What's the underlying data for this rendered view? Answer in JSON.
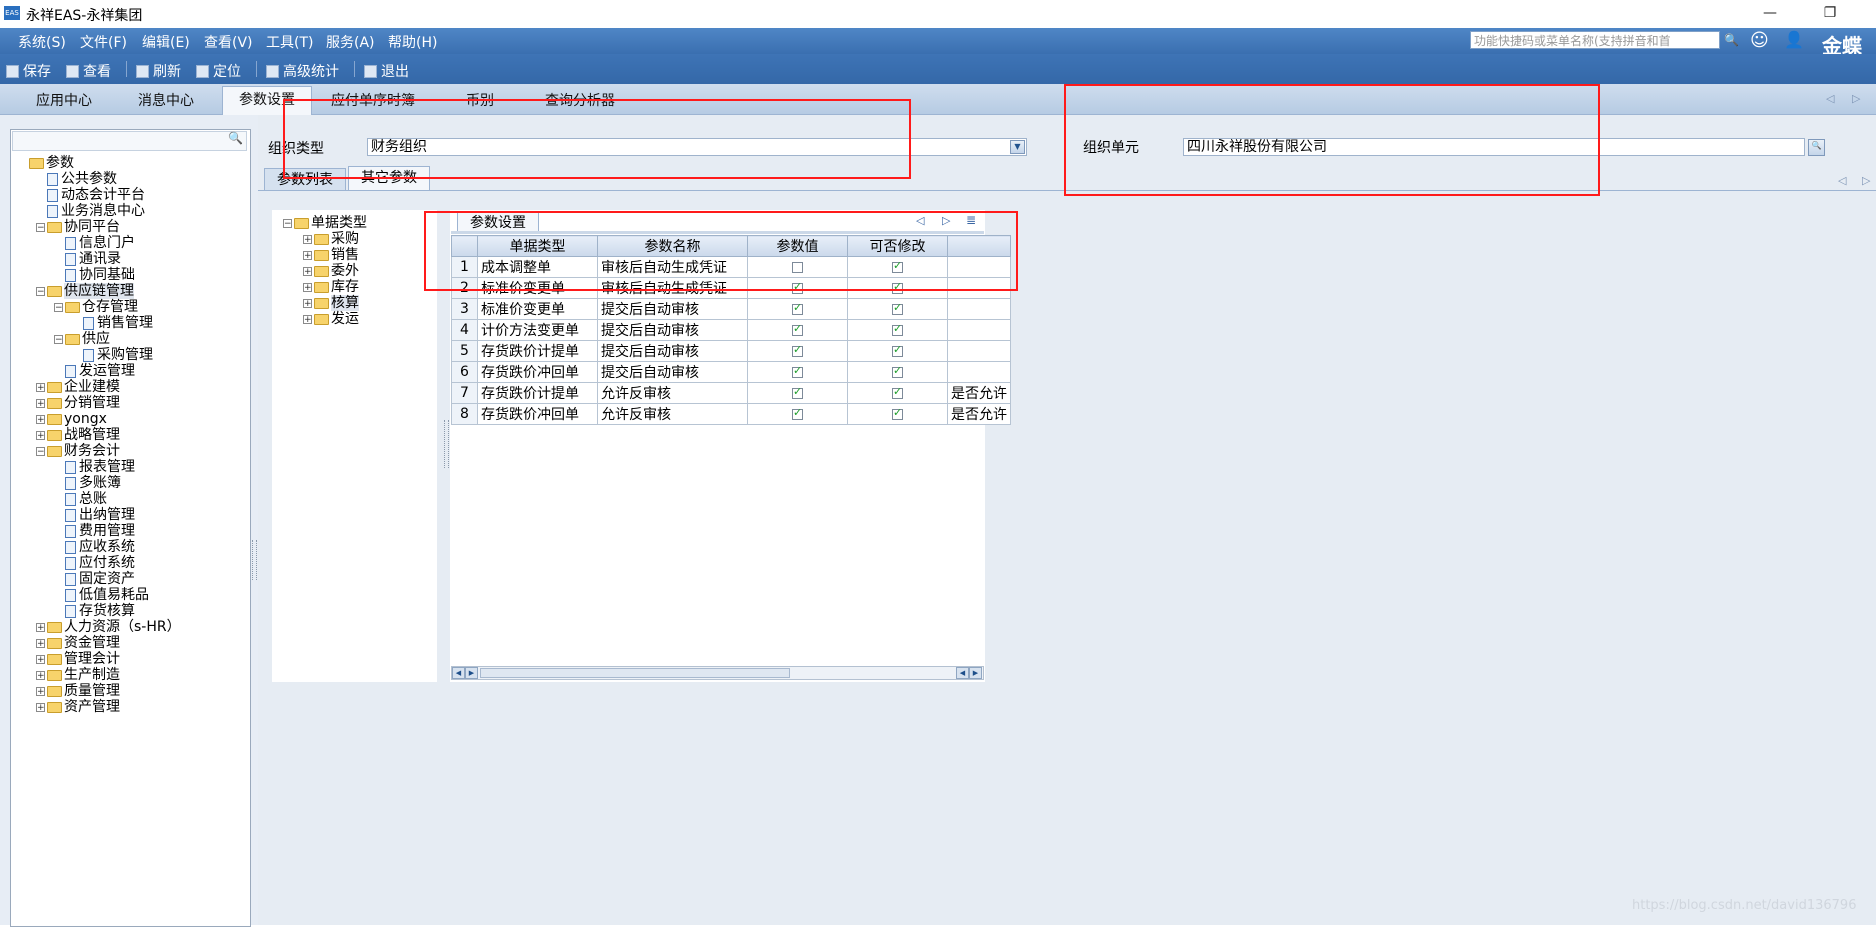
{
  "window": {
    "title": "永祥EAS-永祥集团",
    "app_icon_text": "EAS",
    "minimize_glyph": "—",
    "restore_glyph": "❐"
  },
  "menubar": {
    "items": [
      "系统(S)",
      "文件(F)",
      "编辑(E)",
      "查看(V)",
      "工具(T)",
      "服务(A)",
      "帮助(H)"
    ],
    "quick_search_placeholder": "功能快捷码或菜单名称(支持拼音和首",
    "brand": "金蝶"
  },
  "toolbar": {
    "save": "保存",
    "view": "查看",
    "refresh": "刷新",
    "locate": "定位",
    "advanced_stats": "高级统计",
    "exit": "退出"
  },
  "tabs": [
    {
      "label": "应用中心"
    },
    {
      "label": "消息中心"
    },
    {
      "label": "参数设置"
    },
    {
      "label": "应付单序时簿"
    },
    {
      "label": "币别"
    },
    {
      "label": "查询分析器"
    }
  ],
  "nav_tree": [
    {
      "label": "参数",
      "type": "folder",
      "exp": "",
      "level": 0
    },
    {
      "label": "公共参数",
      "type": "doc",
      "exp": "",
      "level": 1
    },
    {
      "label": "动态会计平台",
      "type": "doc",
      "exp": "",
      "level": 1
    },
    {
      "label": "业务消息中心",
      "type": "doc",
      "exp": "",
      "level": 1
    },
    {
      "label": "协同平台",
      "type": "folder",
      "exp": "-",
      "level": 1
    },
    {
      "label": "信息门户",
      "type": "doc",
      "exp": "",
      "level": 2
    },
    {
      "label": "通讯录",
      "type": "doc",
      "exp": "",
      "level": 2
    },
    {
      "label": "协同基础",
      "type": "doc",
      "exp": "",
      "level": 2
    },
    {
      "label": "供应链管理",
      "type": "folder",
      "exp": "-",
      "level": 1,
      "selected": true
    },
    {
      "label": "仓存管理",
      "type": "folder",
      "exp": "-",
      "level": 2
    },
    {
      "label": "销售管理",
      "type": "doc",
      "exp": "",
      "level": 3
    },
    {
      "label": "供应",
      "type": "folder",
      "exp": "-",
      "level": 2
    },
    {
      "label": "采购管理",
      "type": "doc",
      "exp": "",
      "level": 3
    },
    {
      "label": "发运管理",
      "type": "doc",
      "exp": "",
      "level": 2
    },
    {
      "label": "企业建模",
      "type": "folder",
      "exp": "+",
      "level": 1
    },
    {
      "label": "分销管理",
      "type": "folder",
      "exp": "+",
      "level": 1
    },
    {
      "label": "yongx",
      "type": "folder",
      "exp": "+",
      "level": 1
    },
    {
      "label": "战略管理",
      "type": "folder",
      "exp": "+",
      "level": 1
    },
    {
      "label": "财务会计",
      "type": "folder",
      "exp": "-",
      "level": 1
    },
    {
      "label": "报表管理",
      "type": "doc",
      "exp": "",
      "level": 2
    },
    {
      "label": "多账簿",
      "type": "doc",
      "exp": "",
      "level": 2
    },
    {
      "label": "总账",
      "type": "doc",
      "exp": "",
      "level": 2
    },
    {
      "label": "出纳管理",
      "type": "doc",
      "exp": "",
      "level": 2
    },
    {
      "label": "费用管理",
      "type": "doc",
      "exp": "",
      "level": 2
    },
    {
      "label": "应收系统",
      "type": "doc",
      "exp": "",
      "level": 2
    },
    {
      "label": "应付系统",
      "type": "doc",
      "exp": "",
      "level": 2
    },
    {
      "label": "固定资产",
      "type": "doc",
      "exp": "",
      "level": 2
    },
    {
      "label": "低值易耗品",
      "type": "doc",
      "exp": "",
      "level": 2
    },
    {
      "label": "存货核算",
      "type": "doc",
      "exp": "",
      "level": 2
    },
    {
      "label": "人力资源（s-HR）",
      "type": "folder",
      "exp": "+",
      "level": 1
    },
    {
      "label": "资金管理",
      "type": "folder",
      "exp": "+",
      "level": 1
    },
    {
      "label": "管理会计",
      "type": "folder",
      "exp": "+",
      "level": 1
    },
    {
      "label": "生产制造",
      "type": "folder",
      "exp": "+",
      "level": 1
    },
    {
      "label": "质量管理",
      "type": "folder",
      "exp": "+",
      "level": 1
    },
    {
      "label": "资产管理",
      "type": "folder",
      "exp": "+",
      "level": 1
    }
  ],
  "form": {
    "org_type_label": "组织类型",
    "org_type_value": "财务组织",
    "org_unit_label": "组织单元",
    "org_unit_value": "四川永祥股份有限公司"
  },
  "sub_tabs": [
    "参数列表",
    "其它参数"
  ],
  "doc_tree": [
    {
      "label": "单据类型",
      "exp": "-",
      "level": 0
    },
    {
      "label": "采购",
      "exp": "+",
      "level": 1
    },
    {
      "label": "销售",
      "exp": "+",
      "level": 1
    },
    {
      "label": "委外",
      "exp": "+",
      "level": 1
    },
    {
      "label": "库存",
      "exp": "+",
      "level": 1
    },
    {
      "label": "核算",
      "exp": "+",
      "level": 1,
      "selected": true
    },
    {
      "label": "发运",
      "exp": "+",
      "level": 1
    }
  ],
  "grid": {
    "tab_label": "参数设置",
    "columns": [
      "",
      "单据类型",
      "参数名称",
      "参数值",
      "可否修改",
      ""
    ],
    "rows": [
      {
        "n": "1",
        "bill": "成本调整单",
        "param": "审核后自动生成凭证",
        "value": false,
        "editable": true,
        "extra": ""
      },
      {
        "n": "2",
        "bill": "标准价变更单",
        "param": "审核后自动生成凭证",
        "value": true,
        "editable": true,
        "extra": ""
      },
      {
        "n": "3",
        "bill": "标准价变更单",
        "param": "提交后自动审核",
        "value": true,
        "editable": true,
        "extra": ""
      },
      {
        "n": "4",
        "bill": "计价方法变更单",
        "param": "提交后自动审核",
        "value": true,
        "editable": true,
        "extra": ""
      },
      {
        "n": "5",
        "bill": "存货跌价计提单",
        "param": "提交后自动审核",
        "value": true,
        "editable": true,
        "extra": ""
      },
      {
        "n": "6",
        "bill": "存货跌价冲回单",
        "param": "提交后自动审核",
        "value": true,
        "editable": true,
        "extra": ""
      },
      {
        "n": "7",
        "bill": "存货跌价计提单",
        "param": "允许反审核",
        "value": true,
        "editable": true,
        "extra": "是否允许"
      },
      {
        "n": "8",
        "bill": "存货跌价冲回单",
        "param": "允许反审核",
        "value": true,
        "editable": true,
        "extra": "是否允许"
      }
    ]
  },
  "watermark": "https://blog.csdn.net/david136796",
  "colors": {
    "menubar": "#3a6fb0",
    "annotation_red": "#ff1a1a",
    "check_green": "#1f9e2c"
  }
}
